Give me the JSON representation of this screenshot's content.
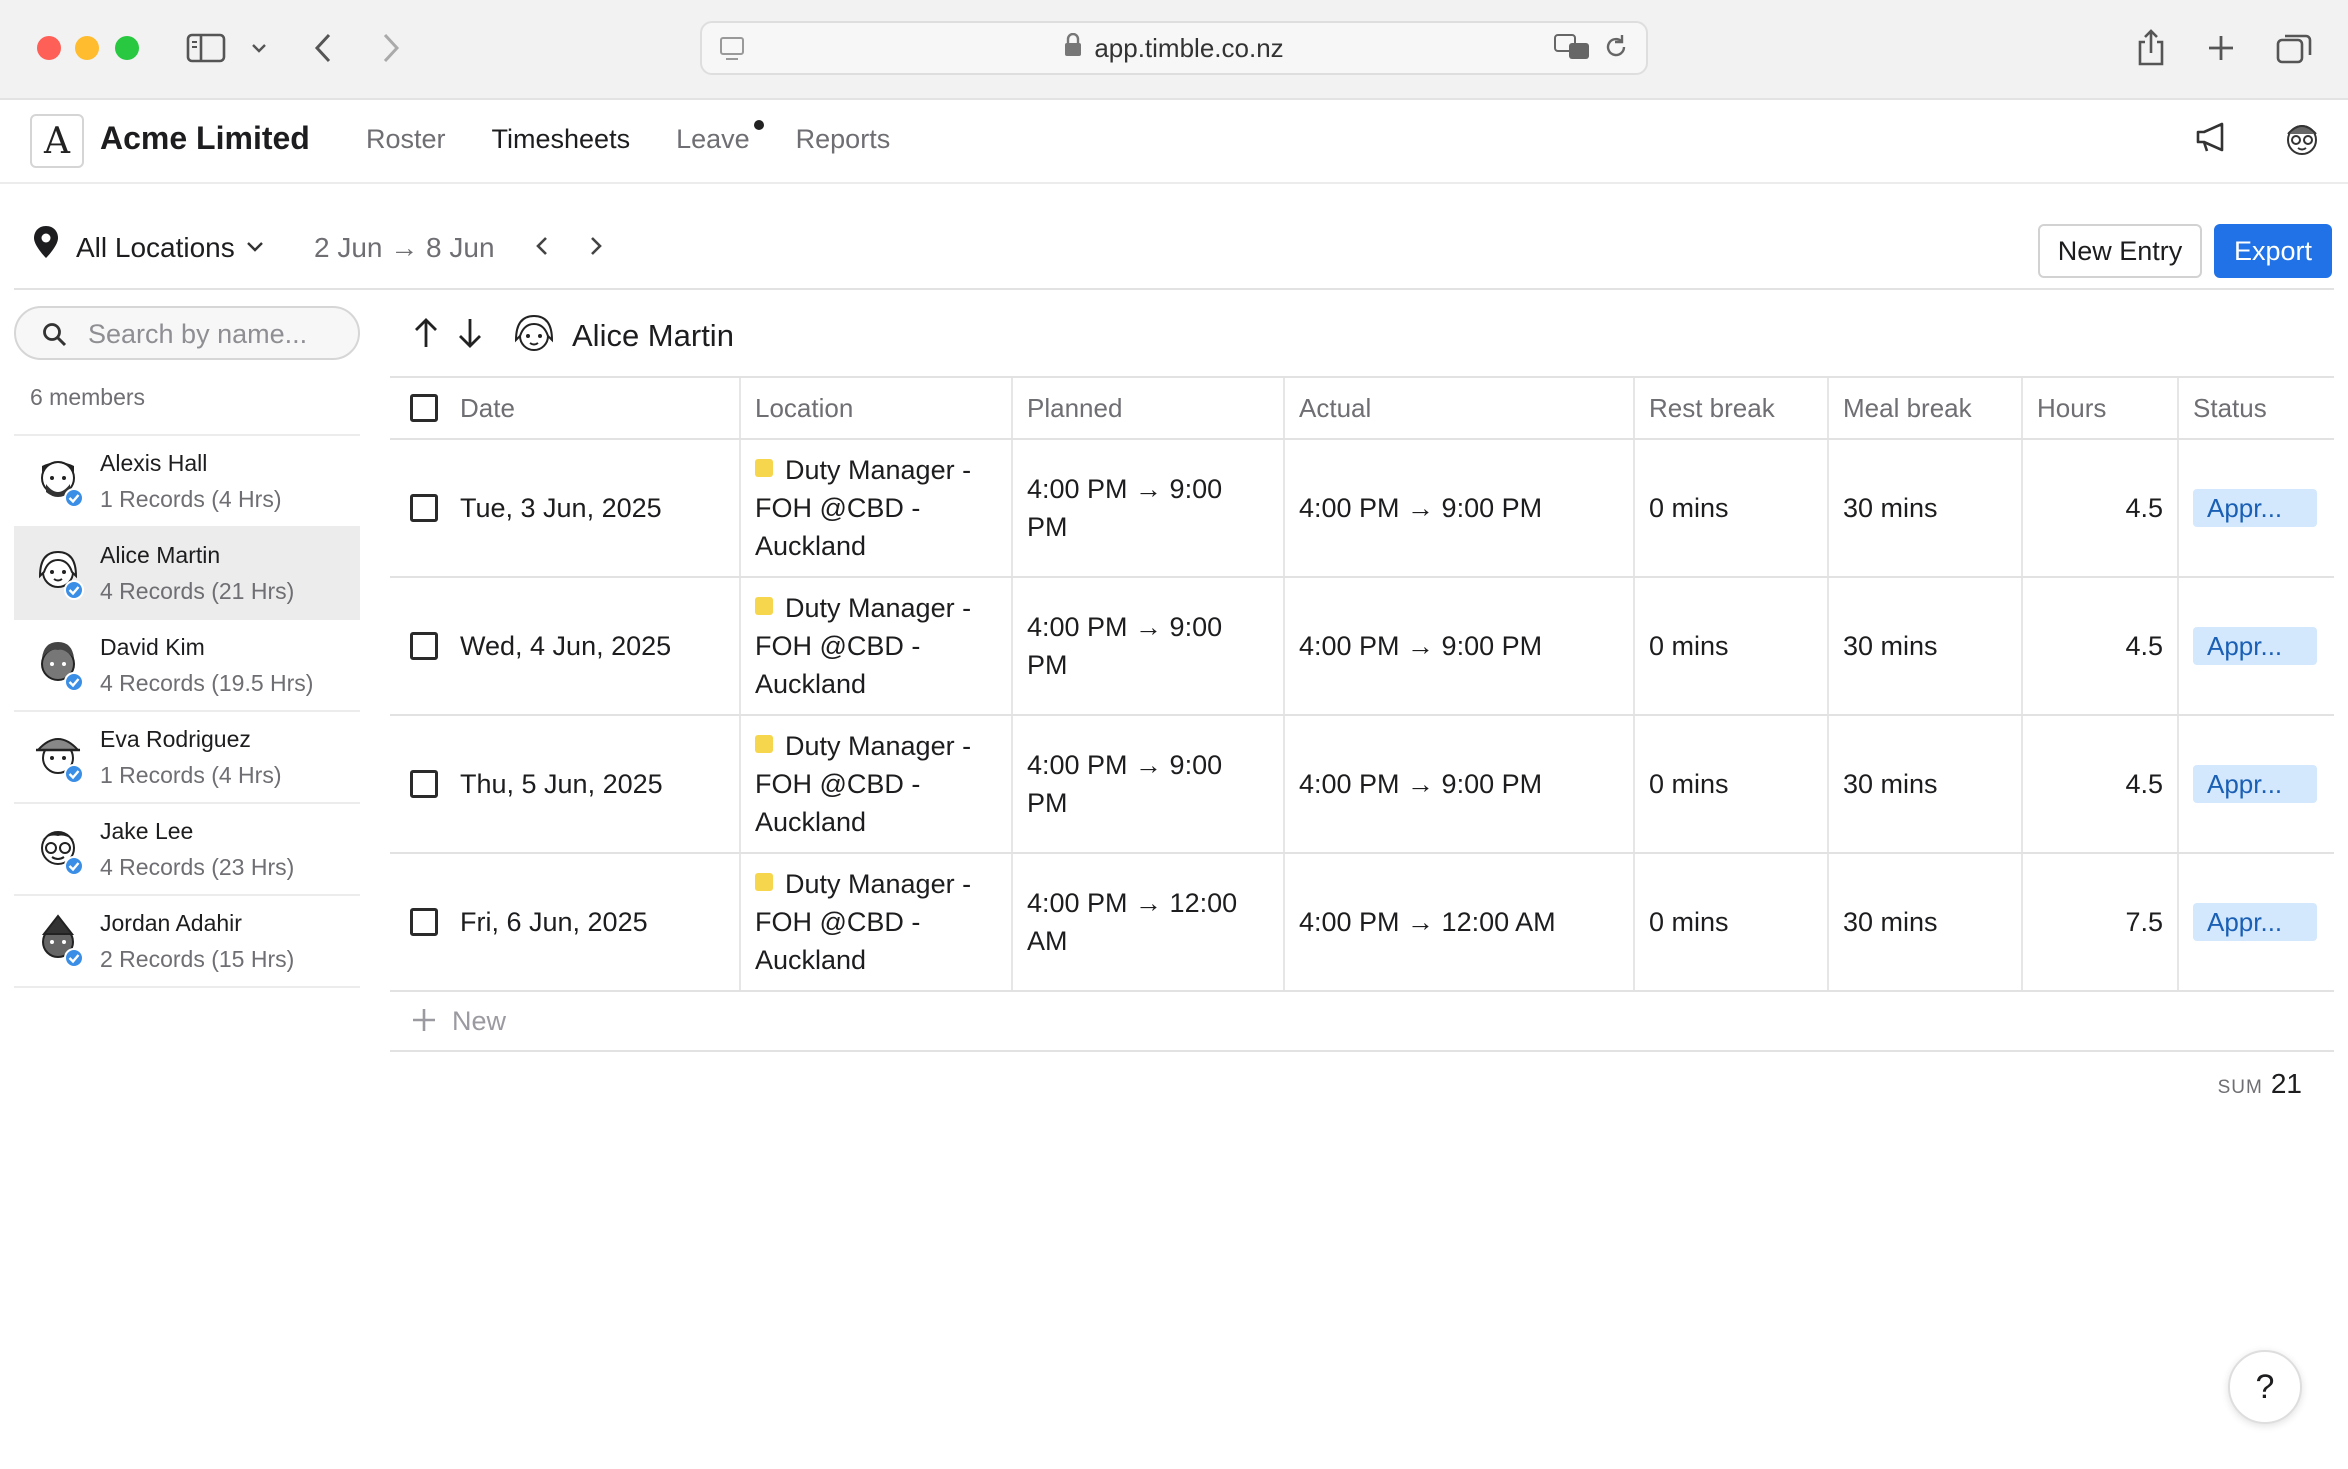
{
  "browser": {
    "url": "app.timble.co.nz"
  },
  "app": {
    "logo_letter": "A",
    "company": "Acme Limited",
    "nav": [
      {
        "label": "Roster"
      },
      {
        "label": "Timesheets"
      },
      {
        "label": "Leave"
      },
      {
        "label": "Reports"
      }
    ],
    "active_nav": "Timesheets"
  },
  "toolbar": {
    "location": "All Locations",
    "date_range": "2 Jun → 8 Jun",
    "new_entry_label": "New Entry",
    "export_label": "Export"
  },
  "sidebar": {
    "search_placeholder": "Search by name...",
    "members_count": "6 members",
    "members": [
      {
        "name": "Alexis Hall",
        "meta": "1 Records (4 Hrs)"
      },
      {
        "name": "Alice Martin",
        "meta": "4 Records (21 Hrs)"
      },
      {
        "name": "David Kim",
        "meta": "4 Records (19.5 Hrs)"
      },
      {
        "name": "Eva Rodriguez",
        "meta": "1 Records (4 Hrs)"
      },
      {
        "name": "Jake Lee",
        "meta": "4 Records (23 Hrs)"
      },
      {
        "name": "Jordan Adahir",
        "meta": "2 Records (15 Hrs)"
      }
    ]
  },
  "main": {
    "person_name": "Alice Martin",
    "columns": [
      "Date",
      "Location",
      "Planned",
      "Actual",
      "Rest break",
      "Meal break",
      "Hours",
      "Status"
    ],
    "rows": [
      {
        "date": "Tue, 3 Jun, 2025",
        "location": "Duty Manager - FOH @CBD - Auckland",
        "planned": "4:00 PM → 9:00 PM",
        "actual": "4:00 PM → 9:00 PM",
        "rest": "0 mins",
        "meal": "30 mins",
        "hours": "4.5",
        "status": "Appr..."
      },
      {
        "date": "Wed, 4 Jun, 2025",
        "location": "Duty Manager - FOH @CBD - Auckland",
        "planned": "4:00 PM → 9:00 PM",
        "actual": "4:00 PM → 9:00 PM",
        "rest": "0 mins",
        "meal": "30 mins",
        "hours": "4.5",
        "status": "Appr..."
      },
      {
        "date": "Thu, 5 Jun, 2025",
        "location": "Duty Manager - FOH @CBD - Auckland",
        "planned": "4:00 PM → 9:00 PM",
        "actual": "4:00 PM → 9:00 PM",
        "rest": "0 mins",
        "meal": "30 mins",
        "hours": "4.5",
        "status": "Appr..."
      },
      {
        "date": "Fri, 6 Jun, 2025",
        "location": "Duty Manager - FOH @CBD - Auckland",
        "planned": "4:00 PM → 12:00 AM",
        "actual": "4:00 PM → 12:00 AM",
        "rest": "0 mins",
        "meal": "30 mins",
        "hours": "7.5",
        "status": "Appr..."
      }
    ],
    "new_label": "New",
    "sum_label": "SUM",
    "sum_value": "21"
  },
  "help_label": "?",
  "colors": {
    "accent": "#2072e6",
    "status_bg": "#d3e8fc",
    "location_tag": "#f6d64c"
  }
}
